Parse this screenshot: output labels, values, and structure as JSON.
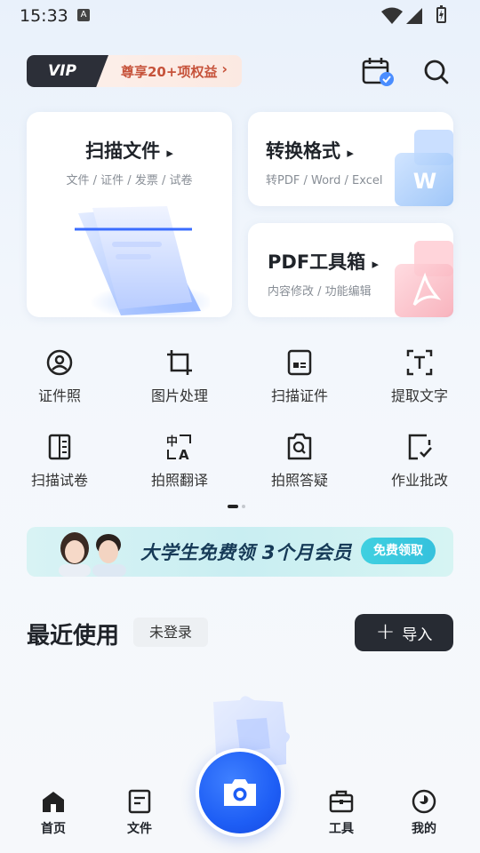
{
  "status_bar": {
    "time": "15:33",
    "a_badge": "A"
  },
  "header": {
    "vip_tag": "VIP",
    "vip_text": "尊享20+项权益",
    "vip_arrow": "›",
    "calendar_icon": "calendar-check-icon",
    "search_icon": "search-icon"
  },
  "cards": {
    "scan": {
      "title": "扫描文件",
      "arrow": "▸",
      "subtitle": "文件 / 证件 / 发票 / 试卷"
    },
    "convert": {
      "title": "转换格式",
      "arrow": "▸",
      "subtitle": "转PDF / Word / Excel",
      "badge": "W"
    },
    "pdf": {
      "title": "PDF工具箱",
      "arrow": "▸",
      "subtitle": "内容修改 / 功能编辑"
    }
  },
  "tools": [
    {
      "label": "证件照",
      "icon": "id-photo-icon"
    },
    {
      "label": "图片处理",
      "icon": "crop-icon"
    },
    {
      "label": "扫描证件",
      "icon": "id-card-scan-icon"
    },
    {
      "label": "提取文字",
      "icon": "text-extract-icon"
    },
    {
      "label": "扫描试卷",
      "icon": "exam-scan-icon"
    },
    {
      "label": "拍照翻译",
      "icon": "translate-icon"
    },
    {
      "label": "拍照答疑",
      "icon": "question-search-icon"
    },
    {
      "label": "作业批改",
      "icon": "homework-check-icon"
    }
  ],
  "banner": {
    "text": "大学生免费领 3个月会员",
    "button": "免费领取"
  },
  "recent": {
    "title": "最近使用",
    "login_chip": "未登录",
    "import_label": "导入",
    "import_plus": "+"
  },
  "bottom_nav": [
    {
      "label": "首页",
      "icon": "home-icon"
    },
    {
      "label": "文件",
      "icon": "file-icon"
    },
    {
      "label": "工具",
      "icon": "toolbox-icon"
    },
    {
      "label": "我的",
      "icon": "profile-icon"
    }
  ],
  "camera": {
    "icon": "camera-icon"
  },
  "colors": {
    "accent": "#1e5ef5",
    "vip_text": "#c6523a",
    "dark_button": "#272b33",
    "banner_button": "#3fd0e0"
  }
}
